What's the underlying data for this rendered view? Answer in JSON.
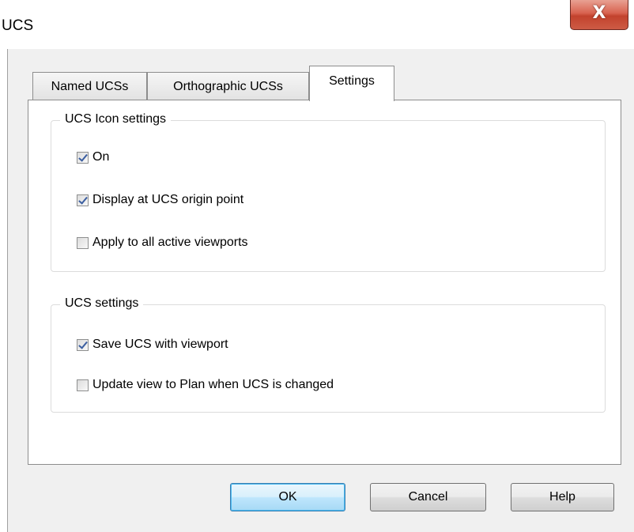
{
  "window": {
    "title": "UCS",
    "close_glyph": "X"
  },
  "tabs": [
    {
      "label": "Named UCSs",
      "active": false
    },
    {
      "label": "Orthographic UCSs",
      "active": false
    },
    {
      "label": "Settings",
      "active": true
    }
  ],
  "icon_settings": {
    "title": "UCS Icon settings",
    "options": [
      {
        "label": "On",
        "checked": true
      },
      {
        "label": "Display at UCS origin point",
        "checked": true
      },
      {
        "label": "Apply to all active viewports",
        "checked": false
      }
    ]
  },
  "ucs_settings": {
    "title": "UCS settings",
    "options": [
      {
        "label": "Save UCS with viewport",
        "checked": true
      },
      {
        "label": "Update view to Plan when UCS is changed",
        "checked": false
      }
    ]
  },
  "buttons": {
    "ok": "OK",
    "cancel": "Cancel",
    "help": "Help"
  },
  "colors": {
    "checkmark": "#3b5ea0",
    "close_button": "#c2422d",
    "default_button_border": "#3c7fb1"
  }
}
